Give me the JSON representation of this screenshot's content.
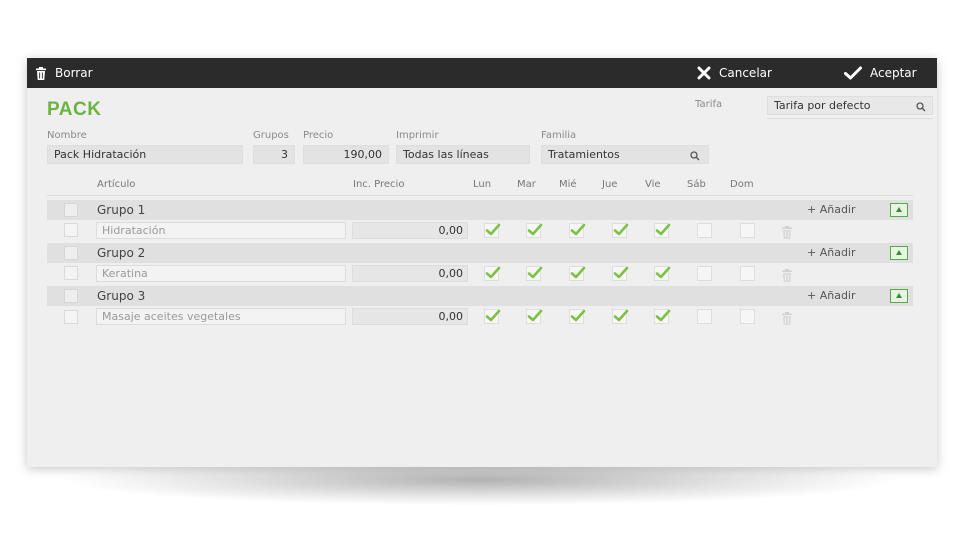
{
  "toolbar": {
    "delete_label": "Borrar",
    "cancel_label": "Cancelar",
    "accept_label": "Aceptar"
  },
  "form": {
    "title": "PACK",
    "tarifa": {
      "label": "Tarifa",
      "value": "Tarifa por defecto"
    },
    "nombre": {
      "label": "Nombre",
      "value": "Pack Hidratación"
    },
    "grupos": {
      "label": "Grupos",
      "value": "3"
    },
    "precio": {
      "label": "Precio",
      "value": "190,00"
    },
    "imprimir": {
      "label": "Imprimir",
      "value": "Todas las líneas"
    },
    "familia": {
      "label": "Familia",
      "value": "Tratamientos"
    }
  },
  "table": {
    "headers": {
      "articulo": "Artículo",
      "inc_precio": "Inc. Precio",
      "days": [
        "Lun",
        "Mar",
        "Mié",
        "Jue",
        "Vie",
        "Sáb",
        "Dom"
      ]
    },
    "add_label": "+ Añadir",
    "groups": [
      {
        "name": "Grupo 1",
        "items": [
          {
            "articulo": "Hidratación",
            "inc_precio": "0,00",
            "days": [
              true,
              true,
              true,
              true,
              true,
              false,
              false
            ]
          }
        ]
      },
      {
        "name": "Grupo 2",
        "items": [
          {
            "articulo": "Keratina",
            "inc_precio": "0,00",
            "days": [
              true,
              true,
              true,
              true,
              true,
              false,
              false
            ]
          }
        ]
      },
      {
        "name": "Grupo 3",
        "items": [
          {
            "articulo": "Masaje aceites vegetales",
            "inc_precio": "0,00",
            "days": [
              true,
              true,
              true,
              true,
              true,
              false,
              false
            ]
          }
        ]
      }
    ]
  },
  "colors": {
    "title_green": "#6db33f",
    "check_green": "#7cc242",
    "topbar": "#2b2b2b"
  }
}
